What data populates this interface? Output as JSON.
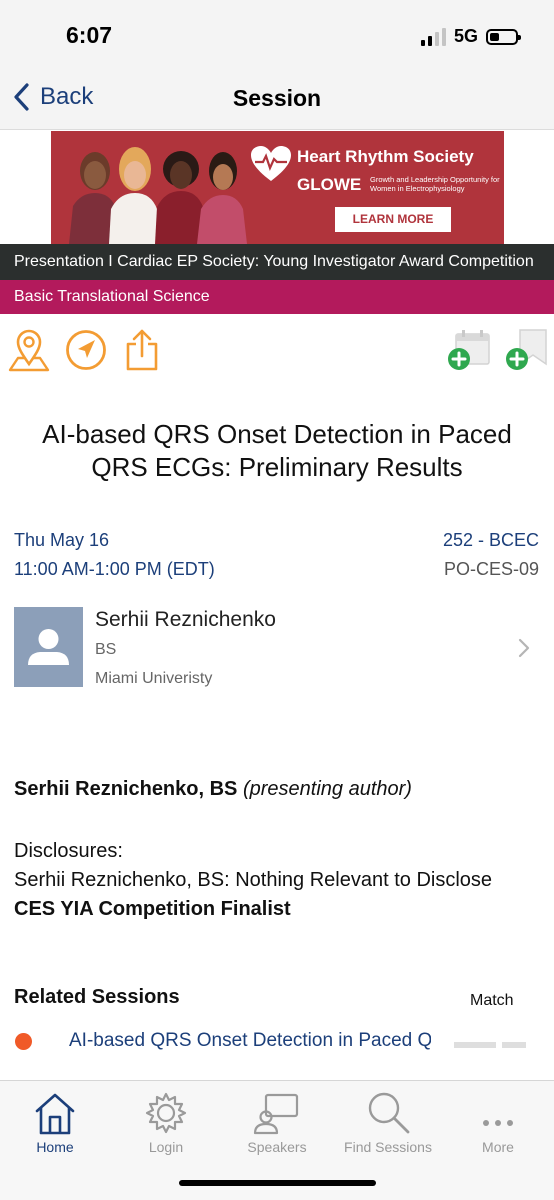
{
  "status": {
    "time": "6:07",
    "network": "5G"
  },
  "nav": {
    "back_label": "Back",
    "title": "Session"
  },
  "ad": {
    "org": "Heart Rhythm Society",
    "program": "GLOWE",
    "tagline": "Growth and Leadership Opportunity for Women in Electrophysiology",
    "cta": "LEARN MORE",
    "background_color": "#b0343c"
  },
  "session": {
    "presentation_type": "Presentation I Cardiac EP Society: Young Investigator Award Competition",
    "track": "Basic Translational Science",
    "track_color": "#b31a5c",
    "title": "AI-based QRS Onset Detection in Paced QRS ECGs: Preliminary Results",
    "date": "Thu May 16",
    "time": "11:00 AM-1:00 PM (EDT)",
    "room": "252 - BCEC",
    "code": "PO-CES-09"
  },
  "actions": {
    "icons": [
      "map-pin-icon",
      "navigate-icon",
      "share-icon",
      "add-to-calendar-icon",
      "add-bookmark-icon"
    ]
  },
  "speaker": {
    "name": "Serhii Reznichenko",
    "degree": "BS",
    "institution": "Miami Univeristy"
  },
  "authors": {
    "name": "Serhii Reznichenko, BS",
    "role": "(presenting author)",
    "disclosures_label": "Disclosures:",
    "disclosure_text": "Serhii Reznichenko, BS: Nothing Relevant to Disclose",
    "note": "CES YIA Competition Finalist"
  },
  "related": {
    "heading": "Related Sessions",
    "match_label": "Match",
    "items": [
      {
        "title": "AI-based QRS Onset Detection in Paced QRS ECGs: Preliminary Results",
        "dot_color": "#f05a28"
      }
    ]
  },
  "tabs": [
    {
      "label": "Home",
      "icon": "home-icon",
      "active": true
    },
    {
      "label": "Login",
      "icon": "gear-icon",
      "active": false
    },
    {
      "label": "Speakers",
      "icon": "speakers-icon",
      "active": false
    },
    {
      "label": "Find Sessions",
      "icon": "search-icon",
      "active": false
    },
    {
      "label": "More",
      "icon": "more-icon",
      "active": false
    }
  ],
  "colors": {
    "link": "#1c3f7a",
    "accent_orange": "#f39c33",
    "add_green": "#2fa84f"
  }
}
